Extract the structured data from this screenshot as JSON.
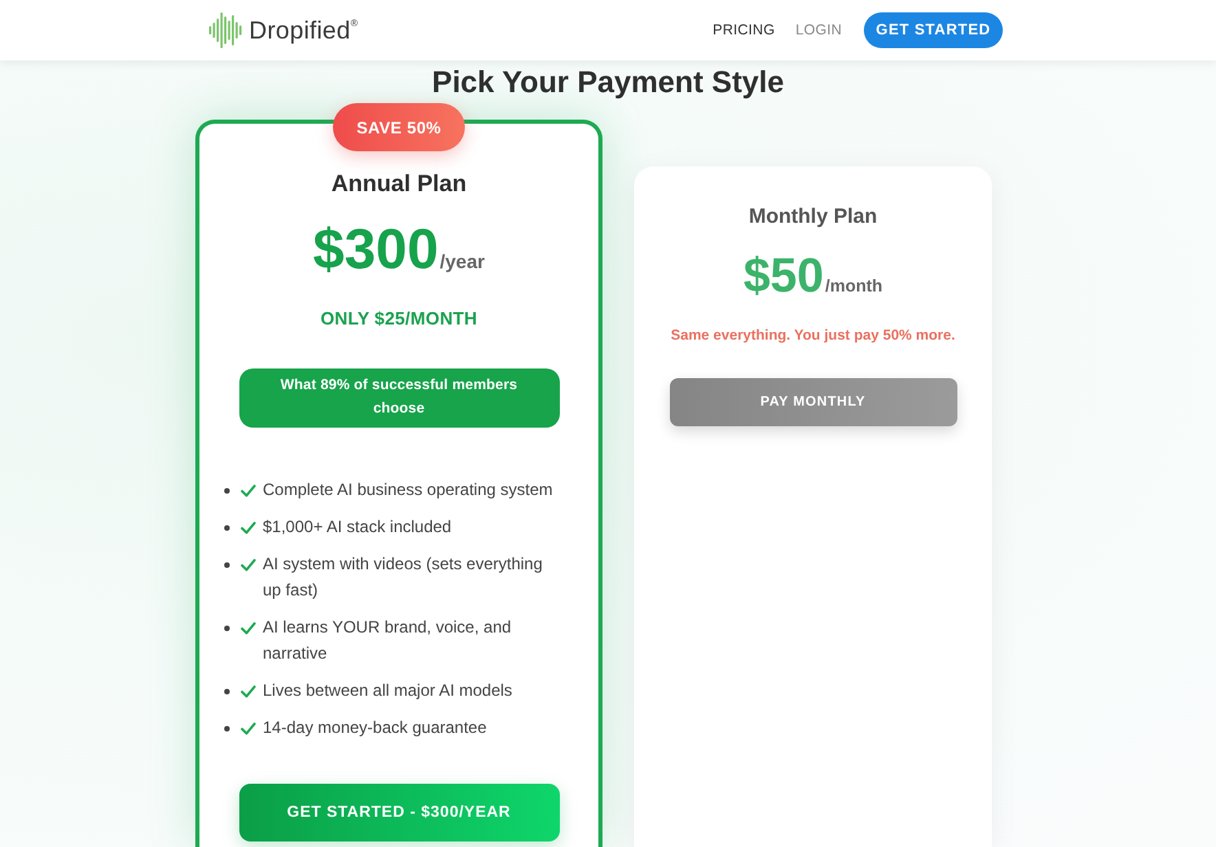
{
  "header": {
    "logo": {
      "text": "Dropified$^{®}$"
    },
    "nav": [
      {
        "label": "PRICING",
        "selected": true
      },
      {
        "label": "LOGIN",
        "selected": false
      }
    ],
    "cta": "GET STARTED"
  },
  "title": "Pick Your Payment Style",
  "plans": [
    {
      "kind": "featured",
      "badge": "SAVE 50%",
      "name": "Annual Plan",
      "price": "$300",
      "period": "/year",
      "subprice": "ONLY $25/MONTH",
      "highlight": "What 89% of successful members choose",
      "features": [
        "Complete AI business operating system",
        "$1,000+ AI stack included",
        "AI system with videos (sets everything up fast)",
        "AI learns YOUR brand, voice, and narrative",
        "Lives between all major AI models",
        "14-day money-back guarantee"
      ],
      "button": "GET STARTED - $300/YEAR"
    },
    {
      "kind": "standard",
      "name": "Monthly Plan",
      "price": "$50",
      "period": "/month",
      "note": "Same everything. You just pay 50% more.",
      "button": "PAY MONTHLY"
    }
  ]
}
